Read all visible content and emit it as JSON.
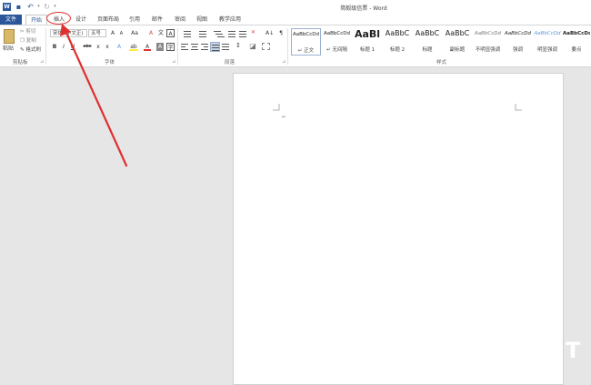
{
  "window": {
    "title": "简毅级信票 - Word"
  },
  "tabs": [
    "文件",
    "开始",
    "插入",
    "设计",
    "页面布局",
    "引用",
    "邮件",
    "审阅",
    "视图",
    "教学应用"
  ],
  "clipboard": {
    "paste": "粘贴",
    "cut": "剪切",
    "copy": "复制",
    "format_painter": "格式刷",
    "group_label": "剪贴板"
  },
  "font": {
    "name": "宋体 (中文正)",
    "size": "五号",
    "grow": "A",
    "shrink": "A",
    "case": "Aa",
    "clear": "A",
    "phonetic": "文",
    "border": "A",
    "bold": "B",
    "italic": "I",
    "underline": "U",
    "strike": "abc",
    "subscript": "x",
    "superscript": "x",
    "effects": "A",
    "highlight": "ab",
    "color": "A",
    "shading": "A",
    "char_border": "字",
    "group_label": "字体"
  },
  "paragraph": {
    "sort": "A↓",
    "marks": "¶",
    "group_label": "段落"
  },
  "styles": {
    "items": [
      {
        "preview": "AaBbCcDd",
        "name": "↵ 正文"
      },
      {
        "preview": "AaBbCcDd",
        "name": "↵ 无间隔"
      },
      {
        "preview": "AaBl",
        "name": "标题 1"
      },
      {
        "preview": "AaBbC",
        "name": "标题 2"
      },
      {
        "preview": "AaBbC",
        "name": "标题"
      },
      {
        "preview": "AaBbC",
        "name": "副标题"
      },
      {
        "preview": "AaBbCcDd",
        "name": "不明显强调"
      },
      {
        "preview": "AaBbCcDd",
        "name": "强调"
      },
      {
        "preview": "AaBbCcDd",
        "name": "明显强调"
      },
      {
        "preview": "AaBbCcDd",
        "name": "要点"
      }
    ],
    "group_label": "样式"
  },
  "colors": {
    "accent": "#2b579a",
    "arrow": "#e03030"
  }
}
